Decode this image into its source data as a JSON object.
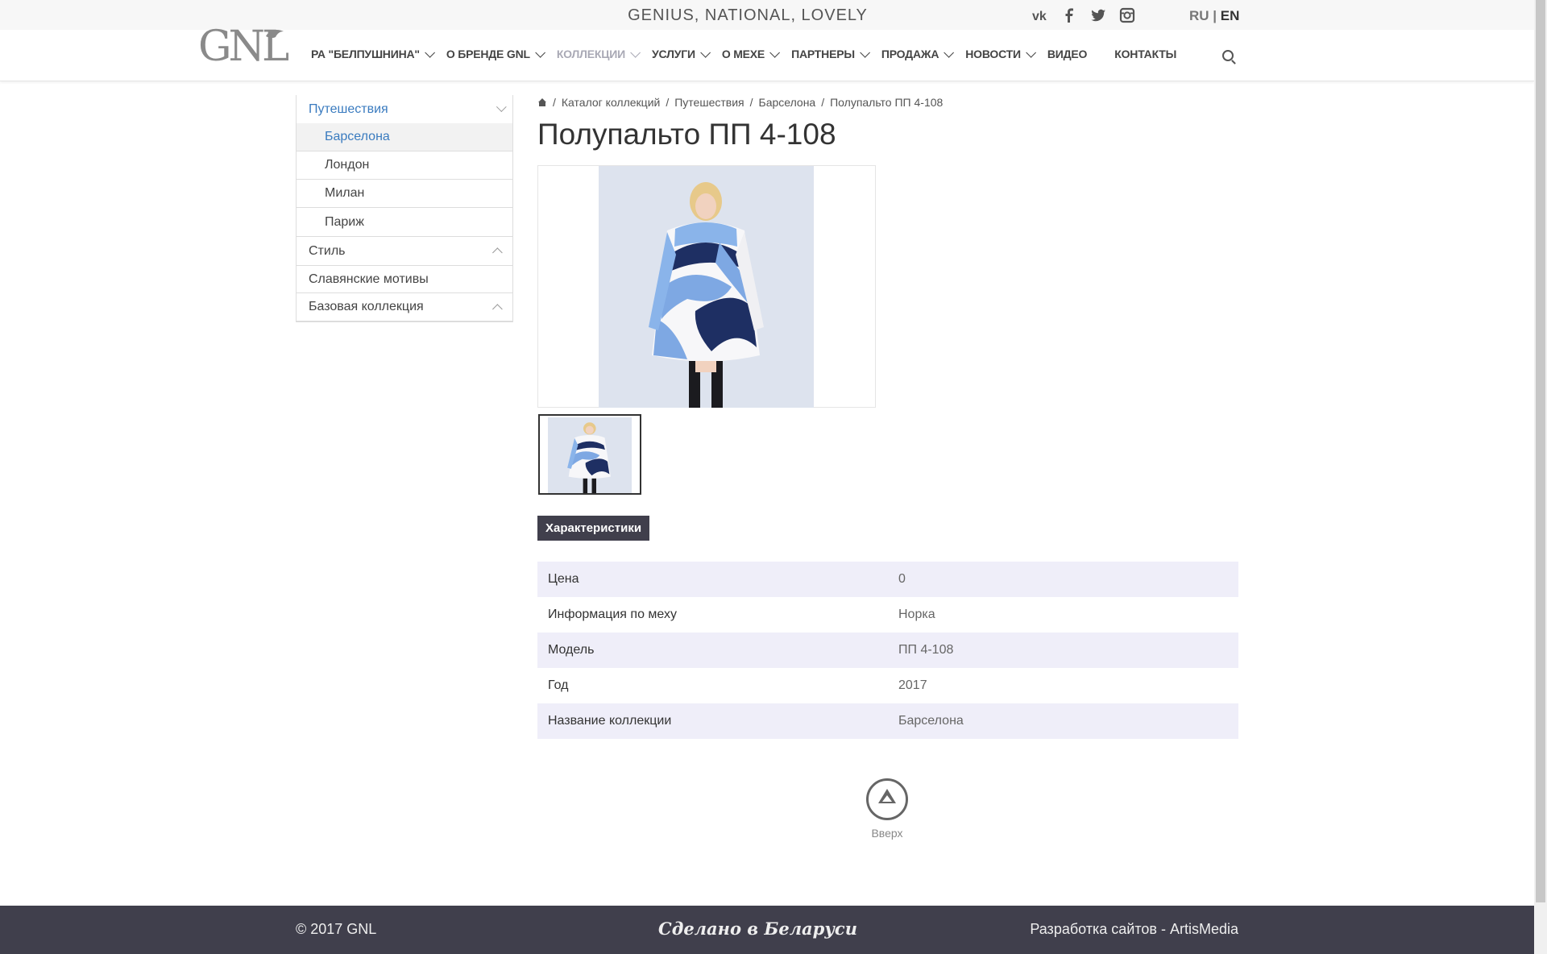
{
  "topbar": {
    "tagline": "GENIUS, NATIONAL, LOVELY",
    "social": [
      "vk-icon",
      "facebook-icon",
      "twitter-icon",
      "instagram-icon"
    ],
    "lang_ru": "RU",
    "lang_sep": "|",
    "lang_en": "EN"
  },
  "logo": {
    "text": "GNL"
  },
  "nav": {
    "items": [
      {
        "label": "РА \"БЕЛПУШНИНА\""
      },
      {
        "label": "О БРЕНДЕ GNL"
      },
      {
        "label": "КОЛЛЕКЦИИ"
      },
      {
        "label": "УСЛУГИ"
      },
      {
        "label": "О МЕХЕ"
      },
      {
        "label": "ПАРТНЕРЫ"
      },
      {
        "label": "ПРОДАЖА"
      },
      {
        "label": "НОВОСТИ"
      },
      {
        "label": "ВИДЕО"
      },
      {
        "label": "КОНТАКТЫ"
      }
    ]
  },
  "sidebar": {
    "travel": "Путешествия",
    "sub": [
      "Барселона",
      "Лондон",
      "Милан",
      "Париж"
    ],
    "style": "Стиль",
    "slavic": "Славянские мотивы",
    "base": "Базовая коллекция"
  },
  "breadcrumb": {
    "items": [
      "Каталог коллекций",
      "Путешествия",
      "Барселона",
      "Полупальто ПП 4-108"
    ],
    "sep": "/"
  },
  "product": {
    "title": "Полупальто ПП 4-108",
    "tab": "Характеристики",
    "specs": [
      {
        "key": "Цена",
        "value": "0"
      },
      {
        "key": "Информация по меху",
        "value": "Норка"
      },
      {
        "key": "Модель",
        "value": "ПП 4-108"
      },
      {
        "key": "Год",
        "value": "2017"
      },
      {
        "key": "Название коллекции",
        "value": "Барселона"
      }
    ]
  },
  "totop": {
    "label": "Вверх"
  },
  "footer": {
    "copyright": "© 2017 GNL",
    "made": "Сделано в Беларуси",
    "developer": "Разработка сайтов - ArtisMedia"
  },
  "colors": {
    "accent": "#3a7bbf",
    "dark": "#403f4c",
    "table_stripe": "#efeef9",
    "nav_active": "#a9a9b5"
  }
}
